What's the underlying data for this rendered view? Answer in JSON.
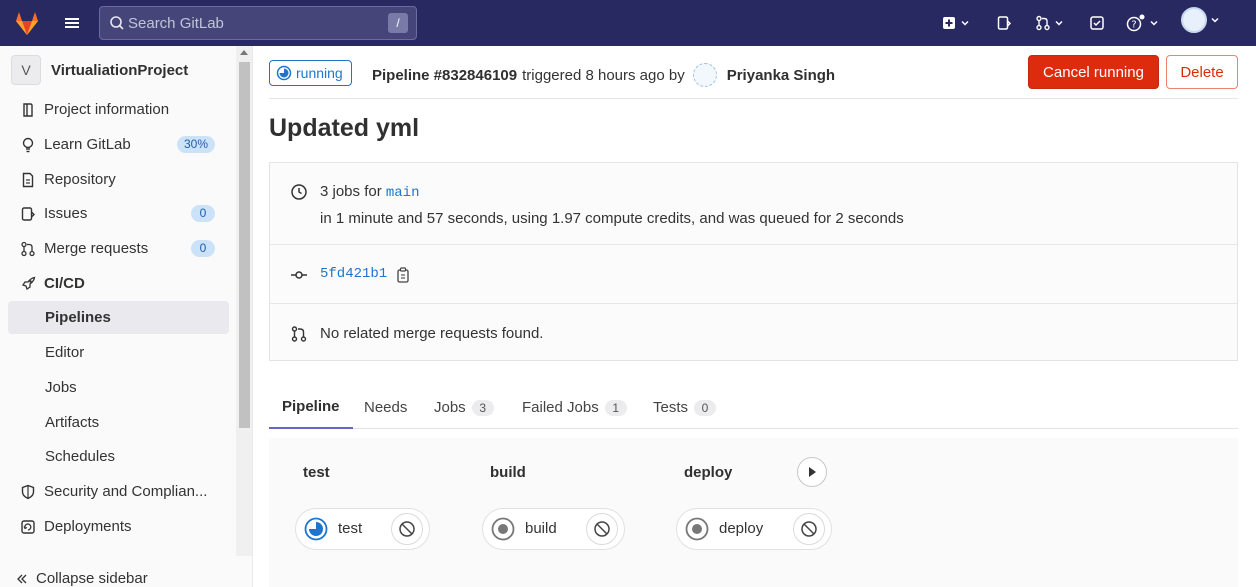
{
  "topbar": {
    "search_placeholder": "Search GitLab",
    "search_shortcut": "/",
    "icons": [
      "gitlab-logo",
      "hamburger-menu",
      "plus-square",
      "issues",
      "merge-requests",
      "todo",
      "help",
      "user-avatar"
    ]
  },
  "sidebar": {
    "project_initial": "V",
    "project_name": "VirtualiationProject",
    "items": [
      {
        "label": "Project information",
        "icon": "project-info"
      },
      {
        "label": "Learn GitLab",
        "icon": "lightbulb",
        "badge": "30%"
      },
      {
        "label": "Repository",
        "icon": "document"
      },
      {
        "label": "Issues",
        "icon": "issues",
        "badge": "0"
      },
      {
        "label": "Merge requests",
        "icon": "merge-request",
        "badge": "0"
      },
      {
        "label": "CI/CD",
        "icon": "rocket"
      },
      {
        "label": "Pipelines"
      },
      {
        "label": "Editor"
      },
      {
        "label": "Jobs"
      },
      {
        "label": "Artifacts"
      },
      {
        "label": "Schedules"
      },
      {
        "label": "Security and Complian...",
        "icon": "shield"
      },
      {
        "label": "Deployments",
        "icon": "deployments"
      }
    ],
    "collapse_label": "Collapse sidebar"
  },
  "pipeline": {
    "status": "running",
    "pipeline_id": "Pipeline #832846109",
    "triggered_text": "triggered 8 hours ago by",
    "user_name": "Priyanka Singh",
    "cancel_label": "Cancel running",
    "delete_label": "Delete",
    "title": "Updated yml",
    "jobs_prefix": "3 jobs for",
    "branch": "main",
    "duration_text": "in 1 minute and 57 seconds, using 1.97 compute credits, and was queued for 2 seconds",
    "commit_sha": "5fd421b1",
    "merge_requests_text": "No related merge requests found."
  },
  "tabs": [
    {
      "label": "Pipeline"
    },
    {
      "label": "Needs"
    },
    {
      "label": "Jobs",
      "count": "3"
    },
    {
      "label": "Failed Jobs",
      "count": "1"
    },
    {
      "label": "Tests",
      "count": "0"
    }
  ],
  "stages": [
    {
      "name": "test",
      "job": "test",
      "job_status": "running"
    },
    {
      "name": "build",
      "job": "build",
      "job_status": "created"
    },
    {
      "name": "deploy",
      "job": "deploy",
      "job_status": "created"
    }
  ],
  "colors": {
    "topbar": "#292961",
    "accent_blue": "#1f75cb",
    "danger": "#dd2b0e"
  }
}
